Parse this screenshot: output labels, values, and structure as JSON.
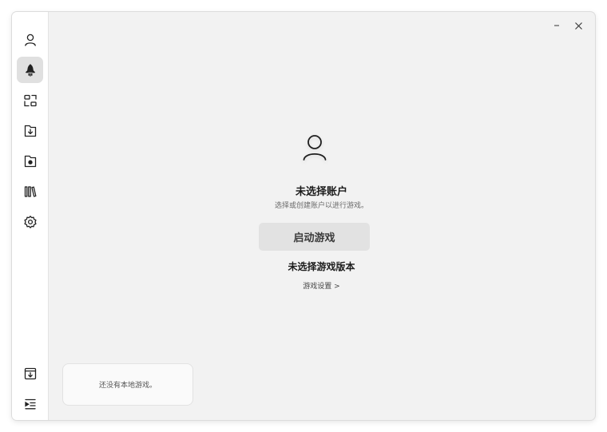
{
  "window": {
    "minimize_icon": "minimize-icon",
    "close_icon": "close-icon"
  },
  "sidebar": {
    "items": [
      {
        "name": "account",
        "icon": "user-icon",
        "active": false
      },
      {
        "name": "launch",
        "icon": "rocket-icon",
        "active": true
      },
      {
        "name": "versions",
        "icon": "layout-icon",
        "active": false
      },
      {
        "name": "download",
        "icon": "download-box-icon",
        "active": false
      },
      {
        "name": "folder",
        "icon": "folder-icon",
        "active": false
      },
      {
        "name": "library",
        "icon": "books-icon",
        "active": false
      },
      {
        "name": "settings",
        "icon": "gear-icon",
        "active": false
      }
    ],
    "bottom_items": [
      {
        "name": "tasks",
        "icon": "archive-download-icon"
      },
      {
        "name": "collapse",
        "icon": "collapse-menu-icon"
      }
    ]
  },
  "main": {
    "account_title": "未选择账户",
    "account_subtitle": "选择或创建账户以进行游戏。",
    "launch_label": "启动游戏",
    "version_title": "未选择游戏版本",
    "game_settings_link": "游戏设置 >"
  },
  "toast": {
    "message": "还没有本地游戏。"
  },
  "colors": {
    "background": "#f2f2f2",
    "sidebar": "#ffffff",
    "active_nav": "#e0e0e0",
    "button": "#e2e2e2"
  }
}
